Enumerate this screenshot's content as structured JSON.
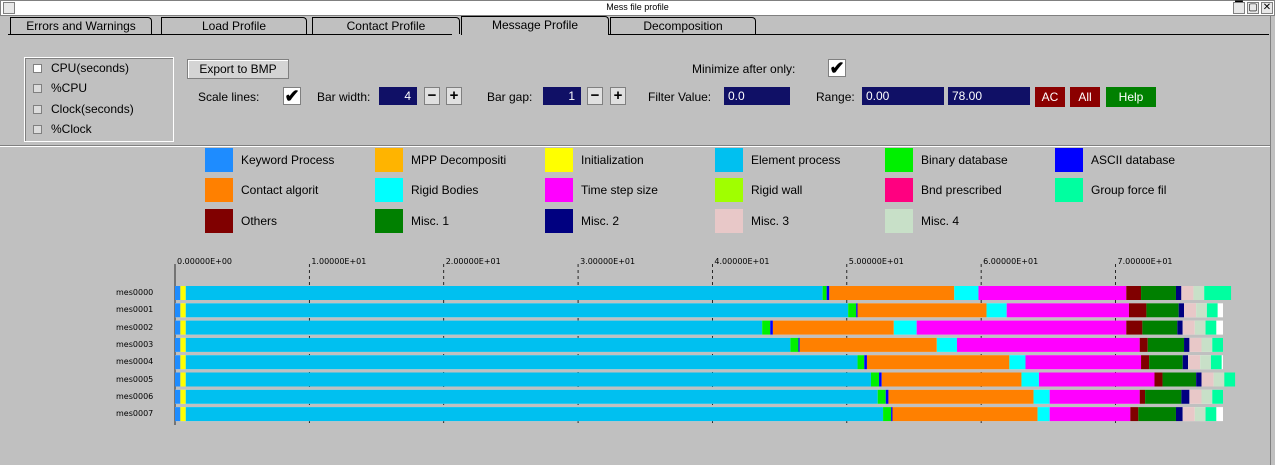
{
  "window": {
    "title": "Mess file profile",
    "minimize": "▔",
    "restore": "▢",
    "close": "✕"
  },
  "tabs": [
    "Errors and Warnings",
    "Load Profile",
    "Contact Profile",
    "Message Profile",
    "Decomposition"
  ],
  "active_tab": "Message Profile",
  "modes": [
    {
      "label": "CPU(seconds)",
      "selected": true
    },
    {
      "label": "%CPU",
      "selected": false
    },
    {
      "label": "Clock(seconds)",
      "selected": false
    },
    {
      "label": "%Clock",
      "selected": false
    }
  ],
  "controls": {
    "export_label": "Export to BMP",
    "minimize_label": "Minimize after only:",
    "minimize_checked": "✔",
    "scale_lines_label": "Scale lines:",
    "scale_lines_checked": "✔",
    "bar_width_label": "Bar width:",
    "bar_width_value": "4",
    "bar_gap_label": "Bar gap:",
    "bar_gap_value": "1",
    "minus": "−",
    "plus": "+",
    "filter_label": "Filter Value:",
    "filter_value": "0.0",
    "range_label": "Range:",
    "range_min": "0.00",
    "range_max": "78.00",
    "ac_label": "AC",
    "all_label": "All",
    "help_label": "Help"
  },
  "legend": [
    {
      "label": "Keyword Process",
      "color": "#1e8cff"
    },
    {
      "label": "MPP Decompositi",
      "color": "#ffb400"
    },
    {
      "label": "Initialization",
      "color": "#ffff00"
    },
    {
      "label": "Element process",
      "color": "#00c0f0"
    },
    {
      "label": "Binary database",
      "color": "#00f000"
    },
    {
      "label": "ASCII database",
      "color": "#0000ff"
    },
    {
      "label": "Contact algorit",
      "color": "#ff8000"
    },
    {
      "label": "Rigid Bodies",
      "color": "#00ffff"
    },
    {
      "label": "Time step size",
      "color": "#ff00ff"
    },
    {
      "label": "Rigid wall",
      "color": "#a0ff00"
    },
    {
      "label": "Bnd prescribed",
      "color": "#ff0080"
    },
    {
      "label": "Group force fil",
      "color": "#00ffa0"
    },
    {
      "label": "Others",
      "color": "#800000"
    },
    {
      "label": "Misc. 1",
      "color": "#008000"
    },
    {
      "label": "Misc. 2",
      "color": "#000080"
    },
    {
      "label": "Misc. 3",
      "color": "#e8c8c8"
    },
    {
      "label": "Misc. 4",
      "color": "#c8e0c8"
    }
  ],
  "chart_data": {
    "type": "bar",
    "orientation": "horizontal-stacked",
    "categories": [
      "mes0000",
      "mes0001",
      "mes0002",
      "mes0003",
      "mes0004",
      "mes0005",
      "mes0006",
      "mes0007"
    ],
    "xlim": [
      0,
      78
    ],
    "x_ticks": [
      "0.00000E+00",
      "1.00000E+01",
      "2.00000E+01",
      "3.00000E+01",
      "4.00000E+01",
      "5.00000E+01",
      "6.00000E+01",
      "7.00000E+01"
    ],
    "x_tick_values": [
      0,
      10,
      20,
      30,
      40,
      50,
      60,
      70
    ],
    "grid": true,
    "segment_order": [
      "Keyword Process",
      "Initialization",
      "Element process",
      "Binary database",
      "ASCII database",
      "Contact algorit",
      "Rigid Bodies",
      "Time step size",
      "Others",
      "Misc. 1",
      "Misc. 2",
      "Misc. 3",
      "Misc. 4",
      "Group force fil"
    ],
    "series": [
      {
        "name": "Keyword Process",
        "values": [
          0.4,
          0.4,
          0.4,
          0.4,
          0.4,
          0.4,
          0.4,
          0.4
        ]
      },
      {
        "name": "Initialization",
        "values": [
          0.4,
          0.4,
          0.4,
          0.4,
          0.4,
          0.4,
          0.4,
          0.4
        ]
      },
      {
        "name": "Element process",
        "values": [
          47.4,
          49.3,
          42.9,
          45.0,
          50.0,
          51.0,
          51.5,
          51.9
        ]
      },
      {
        "name": "Binary database",
        "values": [
          0.3,
          0.6,
          0.6,
          0.6,
          0.5,
          0.6,
          0.6,
          0.6
        ]
      },
      {
        "name": "ASCII database",
        "values": [
          0.2,
          0.1,
          0.2,
          0.1,
          0.2,
          0.2,
          0.2,
          0.1
        ]
      },
      {
        "name": "Contact algorit",
        "values": [
          9.3,
          9.6,
          9.0,
          10.2,
          10.6,
          10.4,
          10.8,
          10.8
        ]
      },
      {
        "name": "Rigid Bodies",
        "values": [
          1.8,
          1.5,
          1.7,
          1.5,
          1.2,
          1.3,
          1.2,
          0.9
        ]
      },
      {
        "name": "Time step size",
        "values": [
          11.0,
          9.1,
          15.6,
          13.6,
          8.6,
          8.6,
          6.7,
          6.0
        ]
      },
      {
        "name": "Others",
        "values": [
          1.1,
          1.3,
          1.2,
          0.6,
          0.6,
          0.6,
          0.4,
          0.6
        ]
      },
      {
        "name": "Misc. 1",
        "values": [
          2.6,
          2.4,
          2.6,
          2.7,
          2.5,
          2.5,
          2.7,
          2.8
        ]
      },
      {
        "name": "Misc. 2",
        "values": [
          0.4,
          0.4,
          0.4,
          0.4,
          0.4,
          0.4,
          0.6,
          0.5
        ]
      },
      {
        "name": "Misc. 3",
        "values": [
          0.9,
          0.9,
          0.9,
          0.9,
          0.9,
          0.9,
          0.9,
          0.9
        ]
      },
      {
        "name": "Misc. 4",
        "values": [
          0.8,
          0.8,
          0.8,
          0.8,
          0.8,
          0.8,
          0.8,
          0.8
        ]
      },
      {
        "name": "Group force fil",
        "values": [
          2.0,
          0.8,
          0.8,
          0.8,
          0.8,
          0.8,
          0.8,
          0.8
        ]
      }
    ]
  }
}
